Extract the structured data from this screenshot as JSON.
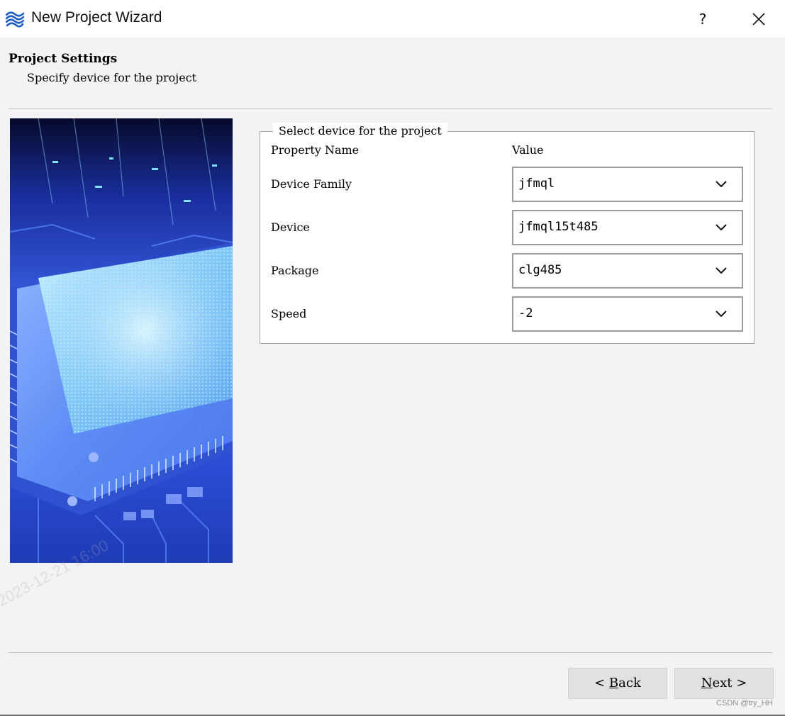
{
  "window": {
    "title": "New Project Wizard",
    "help_label": "?"
  },
  "header": {
    "title": "Project Settings",
    "subtitle": "Specify device for the project"
  },
  "device_group": {
    "legend": "Select device for the project",
    "col_property": "Property Name",
    "col_value": "Value",
    "rows": [
      {
        "label": "Device Family",
        "value": "jfmql"
      },
      {
        "label": "Device",
        "value": "jfmql15t485"
      },
      {
        "label": "Package",
        "value": "clg485"
      },
      {
        "label": "Speed",
        "value": "-2"
      }
    ]
  },
  "buttons": {
    "back_prefix": "< ",
    "back_mnemonic": "B",
    "back_rest": "ack",
    "next_mnemonic": "N",
    "next_rest": "ext >"
  },
  "watermark": {
    "corner": "CSDN @try_HH",
    "date": "2023-12-21 16:00"
  },
  "icons": {
    "app": "wave-logo-icon",
    "close": "close-icon",
    "dropdown": "chevron-down-icon"
  },
  "colors": {
    "window_bg": "#f3f3f5",
    "titlebar_bg": "#ffffff",
    "logo_blue": "#1f5fbf",
    "button_bg": "#e1e1e1",
    "image_blue": "#2b4fd6"
  }
}
